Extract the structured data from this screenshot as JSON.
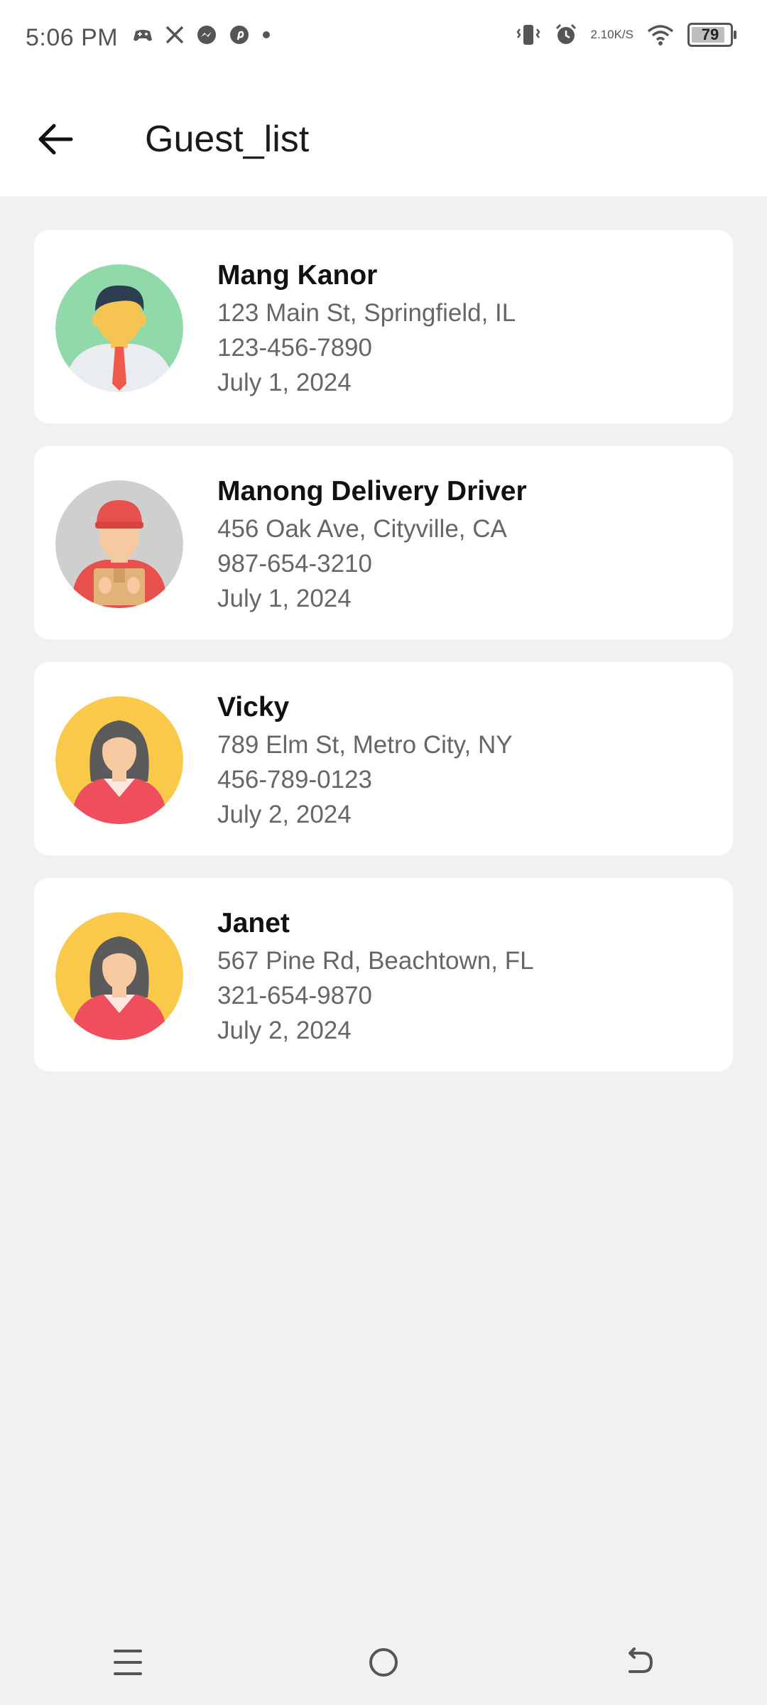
{
  "status_bar": {
    "time": "5:06 PM",
    "left_icons": [
      "game-controller-icon",
      "x-icon",
      "messenger-icon",
      "pinterest-icon",
      "dot-icon"
    ],
    "right_icons": [
      "vibrate-icon",
      "alarm-icon",
      "wifi-icon"
    ],
    "net_speed_value": "2.10",
    "net_speed_unit": "K/S",
    "battery": "79"
  },
  "app_bar": {
    "title": "Guest_list",
    "back_icon": "arrow-left-icon"
  },
  "guests": [
    {
      "name": "Mang Kanor",
      "address": "123 Main St, Springfield, IL",
      "phone": "123-456-7890",
      "date": "July 1, 2024",
      "avatar": "man-tie-avatar",
      "avatar_bg": "#8fdaa8"
    },
    {
      "name": "Manong Delivery Driver",
      "address": "456 Oak Ave, Cityville, CA",
      "phone": "987-654-3210",
      "date": "July 1, 2024",
      "avatar": "delivery-man-avatar",
      "avatar_bg": "#cfcfcf"
    },
    {
      "name": "Vicky",
      "address": "789 Elm St, Metro City, NY",
      "phone": "456-789-0123",
      "date": "July 2, 2024",
      "avatar": "woman-avatar",
      "avatar_bg": "#fbc94a"
    },
    {
      "name": "Janet",
      "address": "567 Pine Rd, Beachtown, FL",
      "phone": "321-654-9870",
      "date": "July 2, 2024",
      "avatar": "woman-avatar",
      "avatar_bg": "#fbc94a"
    }
  ],
  "nav_bar": {
    "items": [
      "menu-icon",
      "home-circle-icon",
      "back-icon"
    ]
  }
}
